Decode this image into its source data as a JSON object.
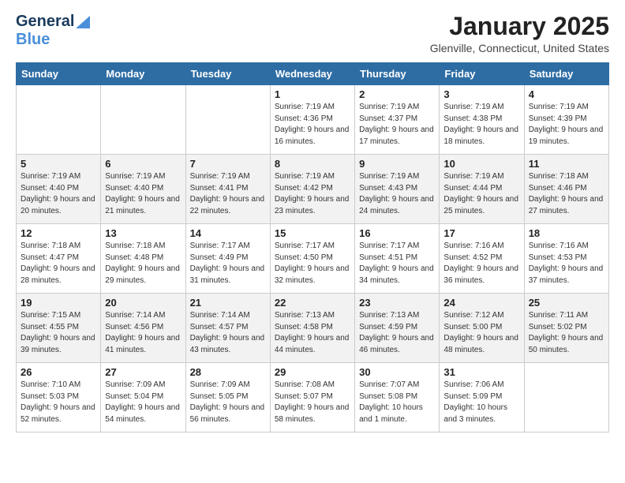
{
  "header": {
    "logo_line1": "General",
    "logo_line2": "Blue",
    "month": "January 2025",
    "location": "Glenville, Connecticut, United States"
  },
  "days_of_week": [
    "Sunday",
    "Monday",
    "Tuesday",
    "Wednesday",
    "Thursday",
    "Friday",
    "Saturday"
  ],
  "weeks": [
    [
      {
        "day": "",
        "info": ""
      },
      {
        "day": "",
        "info": ""
      },
      {
        "day": "",
        "info": ""
      },
      {
        "day": "1",
        "info": "Sunrise: 7:19 AM\nSunset: 4:36 PM\nDaylight: 9 hours\nand 16 minutes."
      },
      {
        "day": "2",
        "info": "Sunrise: 7:19 AM\nSunset: 4:37 PM\nDaylight: 9 hours\nand 17 minutes."
      },
      {
        "day": "3",
        "info": "Sunrise: 7:19 AM\nSunset: 4:38 PM\nDaylight: 9 hours\nand 18 minutes."
      },
      {
        "day": "4",
        "info": "Sunrise: 7:19 AM\nSunset: 4:39 PM\nDaylight: 9 hours\nand 19 minutes."
      }
    ],
    [
      {
        "day": "5",
        "info": "Sunrise: 7:19 AM\nSunset: 4:40 PM\nDaylight: 9 hours\nand 20 minutes."
      },
      {
        "day": "6",
        "info": "Sunrise: 7:19 AM\nSunset: 4:40 PM\nDaylight: 9 hours\nand 21 minutes."
      },
      {
        "day": "7",
        "info": "Sunrise: 7:19 AM\nSunset: 4:41 PM\nDaylight: 9 hours\nand 22 minutes."
      },
      {
        "day": "8",
        "info": "Sunrise: 7:19 AM\nSunset: 4:42 PM\nDaylight: 9 hours\nand 23 minutes."
      },
      {
        "day": "9",
        "info": "Sunrise: 7:19 AM\nSunset: 4:43 PM\nDaylight: 9 hours\nand 24 minutes."
      },
      {
        "day": "10",
        "info": "Sunrise: 7:19 AM\nSunset: 4:44 PM\nDaylight: 9 hours\nand 25 minutes."
      },
      {
        "day": "11",
        "info": "Sunrise: 7:18 AM\nSunset: 4:46 PM\nDaylight: 9 hours\nand 27 minutes."
      }
    ],
    [
      {
        "day": "12",
        "info": "Sunrise: 7:18 AM\nSunset: 4:47 PM\nDaylight: 9 hours\nand 28 minutes."
      },
      {
        "day": "13",
        "info": "Sunrise: 7:18 AM\nSunset: 4:48 PM\nDaylight: 9 hours\nand 29 minutes."
      },
      {
        "day": "14",
        "info": "Sunrise: 7:17 AM\nSunset: 4:49 PM\nDaylight: 9 hours\nand 31 minutes."
      },
      {
        "day": "15",
        "info": "Sunrise: 7:17 AM\nSunset: 4:50 PM\nDaylight: 9 hours\nand 32 minutes."
      },
      {
        "day": "16",
        "info": "Sunrise: 7:17 AM\nSunset: 4:51 PM\nDaylight: 9 hours\nand 34 minutes."
      },
      {
        "day": "17",
        "info": "Sunrise: 7:16 AM\nSunset: 4:52 PM\nDaylight: 9 hours\nand 36 minutes."
      },
      {
        "day": "18",
        "info": "Sunrise: 7:16 AM\nSunset: 4:53 PM\nDaylight: 9 hours\nand 37 minutes."
      }
    ],
    [
      {
        "day": "19",
        "info": "Sunrise: 7:15 AM\nSunset: 4:55 PM\nDaylight: 9 hours\nand 39 minutes."
      },
      {
        "day": "20",
        "info": "Sunrise: 7:14 AM\nSunset: 4:56 PM\nDaylight: 9 hours\nand 41 minutes."
      },
      {
        "day": "21",
        "info": "Sunrise: 7:14 AM\nSunset: 4:57 PM\nDaylight: 9 hours\nand 43 minutes."
      },
      {
        "day": "22",
        "info": "Sunrise: 7:13 AM\nSunset: 4:58 PM\nDaylight: 9 hours\nand 44 minutes."
      },
      {
        "day": "23",
        "info": "Sunrise: 7:13 AM\nSunset: 4:59 PM\nDaylight: 9 hours\nand 46 minutes."
      },
      {
        "day": "24",
        "info": "Sunrise: 7:12 AM\nSunset: 5:00 PM\nDaylight: 9 hours\nand 48 minutes."
      },
      {
        "day": "25",
        "info": "Sunrise: 7:11 AM\nSunset: 5:02 PM\nDaylight: 9 hours\nand 50 minutes."
      }
    ],
    [
      {
        "day": "26",
        "info": "Sunrise: 7:10 AM\nSunset: 5:03 PM\nDaylight: 9 hours\nand 52 minutes."
      },
      {
        "day": "27",
        "info": "Sunrise: 7:09 AM\nSunset: 5:04 PM\nDaylight: 9 hours\nand 54 minutes."
      },
      {
        "day": "28",
        "info": "Sunrise: 7:09 AM\nSunset: 5:05 PM\nDaylight: 9 hours\nand 56 minutes."
      },
      {
        "day": "29",
        "info": "Sunrise: 7:08 AM\nSunset: 5:07 PM\nDaylight: 9 hours\nand 58 minutes."
      },
      {
        "day": "30",
        "info": "Sunrise: 7:07 AM\nSunset: 5:08 PM\nDaylight: 10 hours\nand 1 minute."
      },
      {
        "day": "31",
        "info": "Sunrise: 7:06 AM\nSunset: 5:09 PM\nDaylight: 10 hours\nand 3 minutes."
      },
      {
        "day": "",
        "info": ""
      }
    ]
  ]
}
